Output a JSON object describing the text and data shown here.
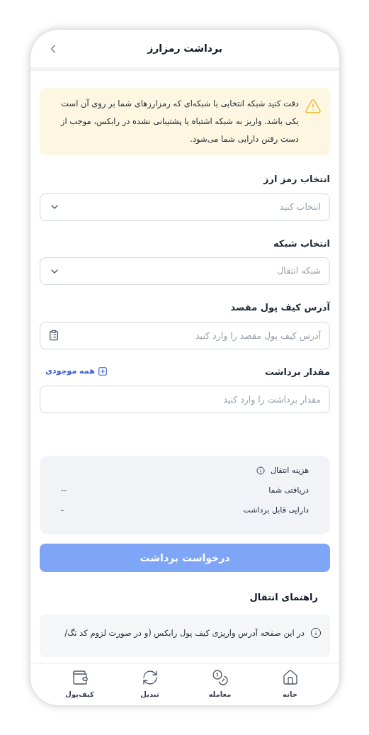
{
  "header": {
    "title": "برداشت رمزارز"
  },
  "warning": {
    "text": "دقت کنید شبکه انتخابی با شبکه‌ای که رمزارزهای شما بر روی آن است یکی باشد. واریز به شبکه اشتباه یا پشتیبانی نشده در رابکس، موجب از دست رفتن دارایی شما می‌شود."
  },
  "fields": [
    {
      "kind": "select",
      "label": "انتخاب رمز ارز",
      "placeholder": "انتخاب کنید"
    },
    {
      "kind": "select",
      "label": "انتخاب شبکه",
      "placeholder": "شبکه انتقال"
    },
    {
      "kind": "paste",
      "label": "آدرس کیف پول مقصد",
      "placeholder": "آدرس کیف پول مقصد را وارد کنید"
    },
    {
      "kind": "input",
      "label": "مقدار برداشت",
      "placeholder": "مقدار برداشت را وارد کنید",
      "action": "همه موجودی"
    }
  ],
  "summary": [
    {
      "label": "هزینه انتقال",
      "has_info": true
    },
    {
      "label": "دریافتی شما",
      "has_info": false,
      "value": "--"
    },
    {
      "label": "دارایی قابل برداشت",
      "has_info": false,
      "value": "-"
    }
  ],
  "submit": {
    "label": "درخواست برداشت",
    "disabled": true
  },
  "guide": {
    "title": "راهنمای انتقال",
    "items": [
      "در این صفحه آدرس واریزی کیف پول رابکس (و در صورت لزوم کد تگ/"
    ]
  },
  "nav": [
    {
      "kind": "home",
      "label": "خانه"
    },
    {
      "kind": "trade",
      "label": "معامله"
    },
    {
      "kind": "convert",
      "label": "تبدیل"
    },
    {
      "kind": "wallet",
      "label": "کیف‌پول"
    }
  ]
}
